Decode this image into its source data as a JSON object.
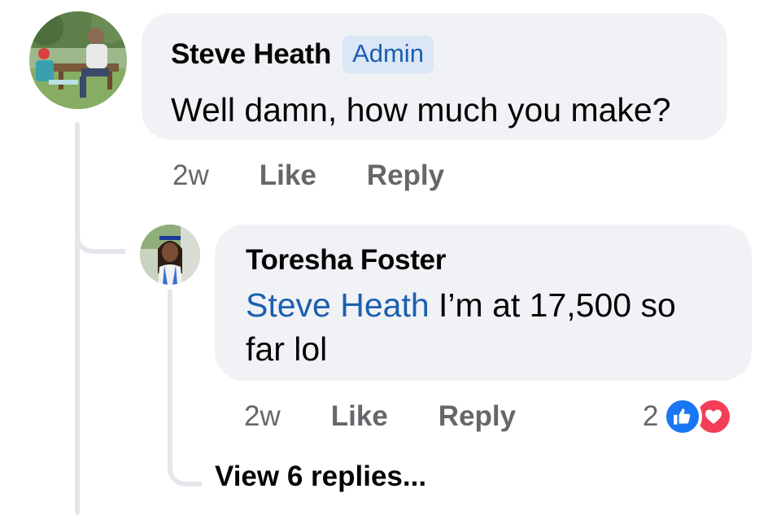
{
  "comment": {
    "author": "Steve Heath",
    "badge": "Admin",
    "text": "Well damn, how much you make?",
    "time": "2w",
    "like_label": "Like",
    "reply_label": "Reply",
    "avatar_icon": "profile-photo-icon"
  },
  "reply": {
    "author": "Toresha Foster",
    "mention": "Steve Heath",
    "text": " I’m at 17,500 so far lol",
    "time": "2w",
    "like_label": "Like",
    "reply_label": "Reply",
    "reaction_count": "2",
    "reactions": [
      "like-reaction-icon",
      "love-reaction-icon"
    ],
    "avatar_icon": "profile-photo-icon"
  },
  "view_replies": "View 6 replies...",
  "colors": {
    "bubble": "#f0f2f5",
    "link": "#1b5fb0",
    "badge_bg": "#dbe7f6",
    "muted": "#65676b",
    "like": "#1877f2",
    "love": "#f33e58"
  }
}
